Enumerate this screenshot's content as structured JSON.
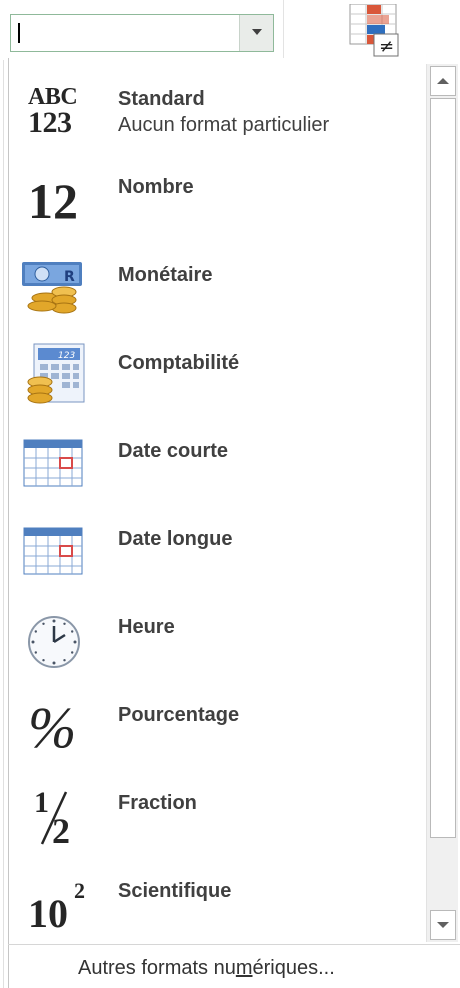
{
  "number_format_combo": {
    "value": "",
    "dropdown_icon": "dropdown-arrow-icon"
  },
  "ribbon": {
    "conditional_format_icon": "conditional-formatting-icon",
    "not_equal_symbol": "≠"
  },
  "formats": [
    {
      "name": "Standard",
      "sub": "Aucun format particulier",
      "icon": "abc-123-icon",
      "glyph_top": "ABC",
      "glyph_bottom": "123"
    },
    {
      "name": "Nombre",
      "icon": "number-12-icon",
      "glyph": "12"
    },
    {
      "name": "Monétaire",
      "icon": "currency-icon"
    },
    {
      "name": "Comptabilité",
      "icon": "accounting-icon",
      "glyph": "123"
    },
    {
      "name": "Date courte",
      "icon": "calendar-icon"
    },
    {
      "name": "Date longue",
      "icon": "calendar-icon"
    },
    {
      "name": "Heure",
      "icon": "clock-icon"
    },
    {
      "name": "Pourcentage",
      "icon": "percent-icon",
      "glyph": "%"
    },
    {
      "name": "Fraction",
      "icon": "fraction-icon",
      "glyph_num": "1",
      "glyph_den": "2"
    },
    {
      "name": "Scientifique",
      "icon": "scientific-icon",
      "glyph_base": "10",
      "glyph_exp": "2"
    }
  ],
  "footer": {
    "pre": "Autres formats nu",
    "accel": "m",
    "post": "ériques..."
  },
  "colors": {
    "combo_border": "#8fb99a",
    "calendar_blue": "#4f7fbf",
    "coin_gold": "#e2a72a",
    "text": "#404040"
  }
}
